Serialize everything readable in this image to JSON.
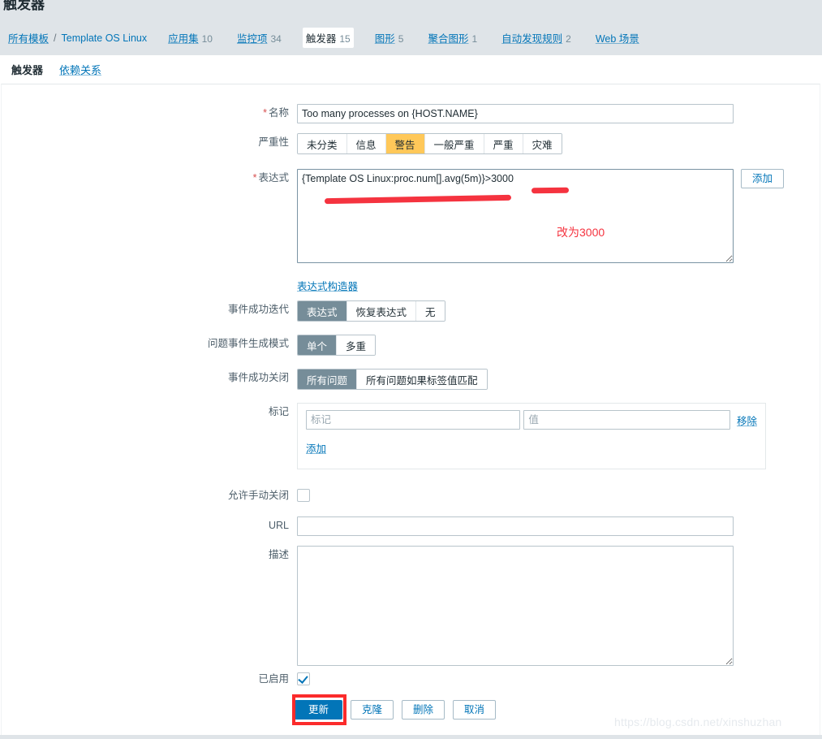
{
  "page": {
    "title": "触发器",
    "watermark": "https://blog.csdn.net/xinshuzhan"
  },
  "breadcrumb": {
    "root": "所有模板",
    "separator": "/",
    "template": "Template OS Linux",
    "items": [
      {
        "label": "应用集",
        "count": "10",
        "active": false
      },
      {
        "label": "监控项",
        "count": "34",
        "active": false
      },
      {
        "label": "触发器",
        "count": "15",
        "active": true
      },
      {
        "label": "图形",
        "count": "5",
        "active": false
      },
      {
        "label": "聚合图形",
        "count": "1",
        "active": false
      },
      {
        "label": "自动发现规则",
        "count": "2",
        "active": false
      },
      {
        "label": "Web 场景",
        "count": "",
        "active": false
      }
    ]
  },
  "subtabs": [
    {
      "label": "触发器",
      "active": true
    },
    {
      "label": "依赖关系",
      "active": false
    }
  ],
  "form": {
    "name": {
      "label": "名称",
      "required": true,
      "value": "Too many processes on {HOST.NAME}",
      "placeholder": ""
    },
    "severity": {
      "label": "严重性",
      "options": [
        {
          "label": "未分类",
          "state": "normal"
        },
        {
          "label": "信息",
          "state": "normal"
        },
        {
          "label": "警告",
          "state": "selected-orange"
        },
        {
          "label": "一般严重",
          "state": "normal"
        },
        {
          "label": "严重",
          "state": "normal"
        },
        {
          "label": "灾难",
          "state": "normal"
        }
      ],
      "selected": "警告"
    },
    "expression": {
      "label": "表达式",
      "required": true,
      "value": "{Template OS Linux:proc.num[].avg(5m)}>3000",
      "add_button": "添加",
      "builder_link": "表达式构造器"
    },
    "ok_event_generation": {
      "label": "事件成功迭代",
      "options": [
        "表达式",
        "恢复表达式",
        "无"
      ],
      "selected": "表达式"
    },
    "problem_event_generation_mode": {
      "label": "问题事件生成模式",
      "options": [
        "单个",
        "多重"
      ],
      "selected": "单个"
    },
    "ok_event_closes": {
      "label": "事件成功关闭",
      "options": [
        "所有问题",
        "所有问题如果标签值匹配"
      ],
      "selected": "所有问题"
    },
    "tags": {
      "label": "标记",
      "rows": [
        {
          "tag_value": "",
          "tag_placeholder": "标记",
          "value_value": "",
          "value_placeholder": "值",
          "remove_label": "移除"
        }
      ],
      "add_label": "添加"
    },
    "allow_manual_close": {
      "label": "允许手动关闭",
      "checked": false
    },
    "url": {
      "label": "URL",
      "value": "",
      "placeholder": ""
    },
    "description": {
      "label": "描述",
      "value": "",
      "placeholder": ""
    },
    "enabled": {
      "label": "已启用",
      "checked": true
    },
    "actions": [
      {
        "label": "更新",
        "kind": "primary",
        "highlighted": true
      },
      {
        "label": "克隆",
        "kind": "outline",
        "highlighted": false
      },
      {
        "label": "删除",
        "kind": "outline",
        "highlighted": false
      },
      {
        "label": "取消",
        "kind": "outline",
        "highlighted": false
      }
    ]
  },
  "annotations": {
    "note_text": "改为3000",
    "stroke_color": "#f5333f",
    "highlight_color": "#fb2b2b"
  }
}
